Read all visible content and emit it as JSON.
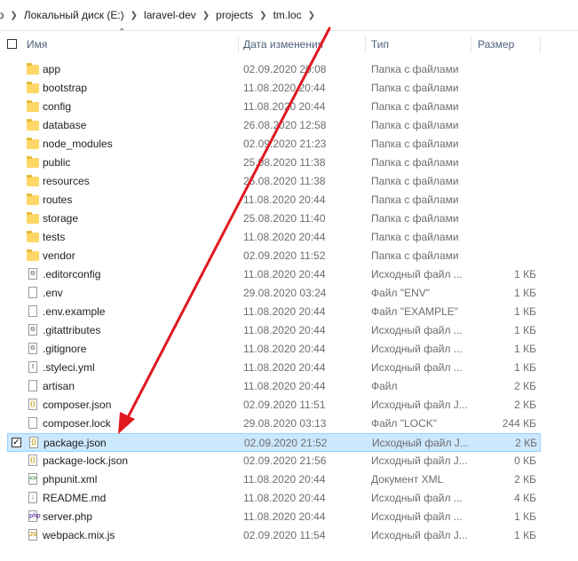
{
  "breadcrumb": [
    "ер",
    "Локальный диск (E:)",
    "laravel-dev",
    "projects",
    "tm.loc"
  ],
  "columns": {
    "name": "Имя",
    "date": "Дата изменения",
    "type": "Тип",
    "size": "Размер"
  },
  "files": [
    {
      "name": "app",
      "date": "02.09.2020 20:08",
      "type": "Папка с файлами",
      "size": "",
      "icon": "folder-icon"
    },
    {
      "name": "bootstrap",
      "date": "11.08.2020 20:44",
      "type": "Папка с файлами",
      "size": "",
      "icon": "folder-icon"
    },
    {
      "name": "config",
      "date": "11.08.2020 20:44",
      "type": "Папка с файлами",
      "size": "",
      "icon": "folder-icon"
    },
    {
      "name": "database",
      "date": "26.08.2020 12:58",
      "type": "Папка с файлами",
      "size": "",
      "icon": "folder-icon"
    },
    {
      "name": "node_modules",
      "date": "02.09.2020 21:23",
      "type": "Папка с файлами",
      "size": "",
      "icon": "folder-icon"
    },
    {
      "name": "public",
      "date": "25.08.2020 11:38",
      "type": "Папка с файлами",
      "size": "",
      "icon": "folder-icon"
    },
    {
      "name": "resources",
      "date": "25.08.2020 11:38",
      "type": "Папка с файлами",
      "size": "",
      "icon": "folder-icon"
    },
    {
      "name": "routes",
      "date": "11.08.2020 20:44",
      "type": "Папка с файлами",
      "size": "",
      "icon": "folder-icon"
    },
    {
      "name": "storage",
      "date": "25.08.2020 11:40",
      "type": "Папка с файлами",
      "size": "",
      "icon": "folder-icon"
    },
    {
      "name": "tests",
      "date": "11.08.2020 20:44",
      "type": "Папка с файлами",
      "size": "",
      "icon": "folder-icon"
    },
    {
      "name": "vendor",
      "date": "02.09.2020 11:52",
      "type": "Папка с файлами",
      "size": "",
      "icon": "folder-icon"
    },
    {
      "name": ".editorconfig",
      "date": "11.08.2020 20:44",
      "type": "Исходный файл ...",
      "size": "1 КБ",
      "icon": "settings-file-icon"
    },
    {
      "name": ".env",
      "date": "29.08.2020 03:24",
      "type": "Файл \"ENV\"",
      "size": "1 КБ",
      "icon": "file-icon"
    },
    {
      "name": ".env.example",
      "date": "11.08.2020 20:44",
      "type": "Файл \"EXAMPLE\"",
      "size": "1 КБ",
      "icon": "file-icon"
    },
    {
      "name": ".gitattributes",
      "date": "11.08.2020 20:44",
      "type": "Исходный файл ...",
      "size": "1 КБ",
      "icon": "settings-file-icon"
    },
    {
      "name": ".gitignore",
      "date": "11.08.2020 20:44",
      "type": "Исходный файл ...",
      "size": "1 КБ",
      "icon": "settings-file-icon"
    },
    {
      "name": ".styleci.yml",
      "date": "11.08.2020 20:44",
      "type": "Исходный файл ...",
      "size": "1 КБ",
      "icon": "yml-file-icon"
    },
    {
      "name": "artisan",
      "date": "11.08.2020 20:44",
      "type": "Файл",
      "size": "2 КБ",
      "icon": "file-icon"
    },
    {
      "name": "composer.json",
      "date": "02.09.2020 11:51",
      "type": "Исходный файл J...",
      "size": "2 КБ",
      "icon": "json-file-icon"
    },
    {
      "name": "composer.lock",
      "date": "29.08.2020 03:13",
      "type": "Файл \"LOCK\"",
      "size": "244 КБ",
      "icon": "file-icon"
    },
    {
      "name": "package.json",
      "date": "02.09.2020 21:52",
      "type": "Исходный файл J...",
      "size": "2 КБ",
      "icon": "json-file-icon",
      "selected": true
    },
    {
      "name": "package-lock.json",
      "date": "02.09.2020 21:56",
      "type": "Исходный файл J...",
      "size": "0 КБ",
      "icon": "json-file-icon"
    },
    {
      "name": "phpunit.xml",
      "date": "11.08.2020 20:44",
      "type": "Документ XML",
      "size": "2 КБ",
      "icon": "xml-file-icon"
    },
    {
      "name": "README.md",
      "date": "11.08.2020 20:44",
      "type": "Исходный файл ...",
      "size": "4 КБ",
      "icon": "md-file-icon"
    },
    {
      "name": "server.php",
      "date": "11.08.2020 20:44",
      "type": "Исходный файл ...",
      "size": "1 КБ",
      "icon": "php-file-icon"
    },
    {
      "name": "webpack.mix.js",
      "date": "02.09.2020 11:54",
      "type": "Исходный файл J...",
      "size": "1 КБ",
      "icon": "js-file-icon"
    }
  ],
  "annotation": {
    "color": "#e0191f"
  }
}
